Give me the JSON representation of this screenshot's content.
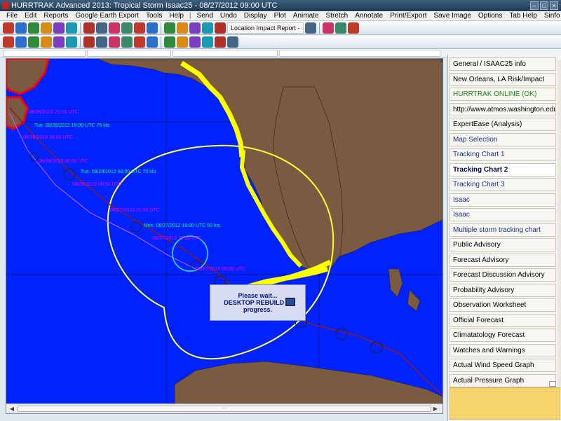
{
  "window": {
    "title": "HURRTRAK Advanced 2013: Tropical Storm Isaac25 - 08/27/2012 09:00 UTC"
  },
  "menu": [
    "File",
    "Edit",
    "Reports",
    "Google Earth Export",
    "Tools",
    "Help",
    "|",
    "Send",
    "Undo",
    "Display",
    "Plot",
    "Animate",
    "Stretch",
    "Annotate",
    "Print/Export",
    "Save Image",
    "Options",
    "Tab Help",
    "Sinfo Email"
  ],
  "toolbar": {
    "location_report_label": "Location Impact Report -",
    "icons1": [
      "close-icon",
      "window-icon",
      "globe-icon",
      "panel-icon",
      "storm-icon",
      "document-icon",
      "folder-icon",
      "page-icon",
      "chart-icon",
      "star-icon",
      "print-icon",
      "camera-icon",
      "image-icon",
      "earth-icon",
      "map-icon",
      "dollar-icon",
      "tornado-icon",
      "radar-icon",
      "satellite-icon",
      "plus-icon",
      "alert-icon"
    ],
    "icons2": [
      "cursor-icon",
      "house-icon",
      "stretch-icon",
      "flag-icon",
      "save-icon",
      "copy-icon",
      "paste-icon",
      "layers-icon",
      "pointer-icon",
      "rotate-icon",
      "arrow-icon",
      "pin-icon",
      "hash-icon",
      "grid-icon",
      "terrain-icon",
      "zoom-in-icon",
      "zoom-out-icon",
      "target-icon"
    ]
  },
  "map": {
    "track_labels": [
      {
        "text": "08/28/2013 21:00 UTC",
        "color": "#ff00ff"
      },
      {
        "text": "Tue. 08/28/2012 18:00 UTC 75 kts",
        "color": "#00ff66"
      },
      {
        "text": "08/28/2013 18:00 UTC",
        "color": "#ff00ff"
      },
      {
        "text": "08/28/2013 06:00 UTC",
        "color": "#ff00ff"
      },
      {
        "text": "Tue. 08/28/2012 06:00 UTC 70 kts",
        "color": "#00ff66"
      },
      {
        "text": "08/28/2013 00:00 UTC",
        "color": "#ff00ff"
      },
      {
        "text": "08/27/2013 21:00 UTC",
        "color": "#ff00ff"
      },
      {
        "text": "Mon. 08/27/2012 18:00 UTC 60 kts",
        "color": "#00ff66"
      },
      {
        "text": "08/27/2013 12:00 UTC",
        "color": "#ff00ff"
      },
      {
        "text": "08/27/2013 09:00 UTC",
        "color": "#ff00ff"
      }
    ]
  },
  "popup": {
    "line1": "Please wait...",
    "line2": "DESKTOP REBUILD in",
    "line3": "progress."
  },
  "panel": {
    "close": "×",
    "items": [
      {
        "label": "General / ISAAC25 info",
        "style": "normal"
      },
      {
        "label": "New Orleans, LA Risk/Impact",
        "style": "normal"
      },
      {
        "label": "HURRTRAK ONLINE (OK)",
        "style": "online"
      },
      {
        "label": "http://www.atmos.washington.edu/c",
        "style": "normal"
      },
      {
        "label": "ExpertEase (Analysis)",
        "style": "normal"
      },
      {
        "label": "Map Selection",
        "style": "link"
      },
      {
        "label": "Tracking Chart 1",
        "style": "link"
      },
      {
        "label": "Tracking Chart 2",
        "style": "active"
      },
      {
        "label": "Tracking Chart 3",
        "style": "link"
      },
      {
        "label": "Isaac",
        "style": "link"
      },
      {
        "label": "Isaac",
        "style": "link"
      },
      {
        "label": "Multiple storm tracking chart",
        "style": "link"
      },
      {
        "label": "Public Advisory",
        "style": "normal"
      },
      {
        "label": "Forecast Advisory",
        "style": "normal"
      },
      {
        "label": "Forecast Discussion Advisory",
        "style": "normal"
      },
      {
        "label": "Probability Advisory",
        "style": "normal"
      },
      {
        "label": "Observation Worksheet",
        "style": "normal"
      },
      {
        "label": "Official Forecast",
        "style": "normal"
      },
      {
        "label": "Climatatology Forecast",
        "style": "normal"
      },
      {
        "label": "Watches and Warnings",
        "style": "normal"
      },
      {
        "label": "Actual Wind Speed Graph",
        "style": "normal"
      },
      {
        "label": "Actual Pressure Graph",
        "style": "normal"
      }
    ]
  },
  "colors": {
    "ocean": "#0022ff",
    "land": "#7a5a40",
    "warning_band": "#ffff00",
    "coast_red": "#ff0000",
    "track": "#8b1a2a",
    "forecast_circle": "#ffff33"
  }
}
